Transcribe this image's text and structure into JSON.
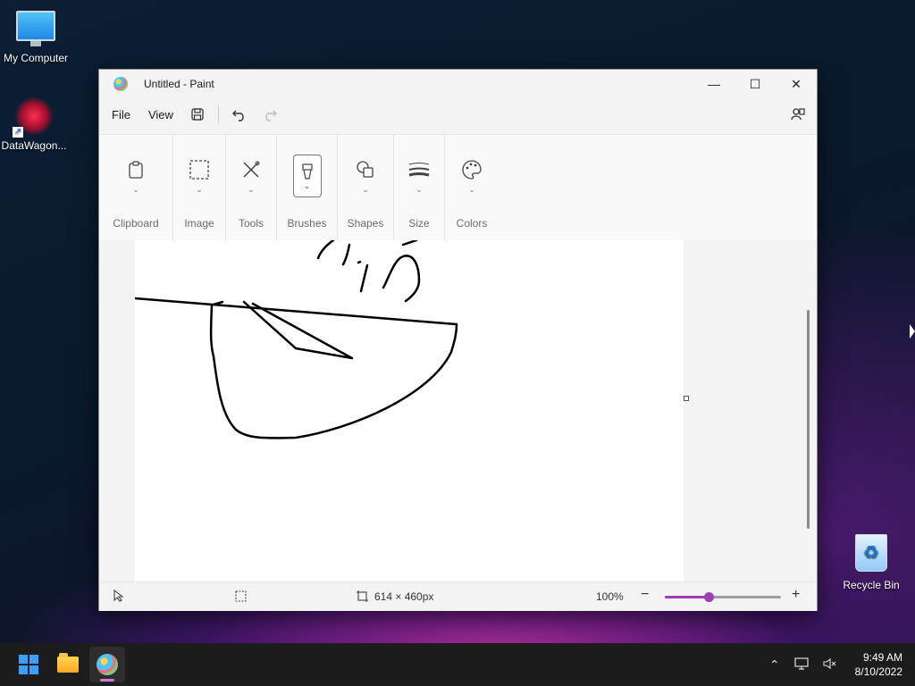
{
  "desktop": {
    "icons": [
      {
        "label": "My Computer",
        "icon": "monitor-icon"
      },
      {
        "label": "DataWagon...",
        "icon": "datawagon-icon"
      },
      {
        "label": "Recycle Bin",
        "icon": "recycle-bin-icon"
      }
    ]
  },
  "window": {
    "title": "Untitled - Paint",
    "controls": {
      "minimize": "—",
      "maximize": "☐",
      "close": "✕"
    }
  },
  "menubar": {
    "file": "File",
    "view": "View",
    "save_icon": "save-icon",
    "undo_icon": "undo-icon",
    "redo_icon": "redo-icon",
    "account_icon": "account-icon"
  },
  "ribbon": {
    "groups": [
      {
        "label": "Clipboard",
        "icon": "clipboard-icon"
      },
      {
        "label": "Image",
        "icon": "selection-icon"
      },
      {
        "label": "Tools",
        "icon": "tools-icon"
      },
      {
        "label": "Brushes",
        "icon": "brush-icon"
      },
      {
        "label": "Shapes",
        "icon": "shapes-icon"
      },
      {
        "label": "Size",
        "icon": "size-icon"
      },
      {
        "label": "Colors",
        "icon": "palette-icon"
      }
    ]
  },
  "status": {
    "canvas_size": "614 × 460px",
    "zoom": "100%",
    "zoom_level": 0.38
  },
  "taskbar": {
    "apps": [
      "start-icon",
      "file-explorer-icon",
      "paint-icon"
    ],
    "time": "9:49 AM",
    "date": "8/10/2022"
  },
  "colors": {
    "accent": "#9b3fb0",
    "window_bg": "#f3f3f3",
    "taskbar_bg": "#1c1c1c"
  }
}
